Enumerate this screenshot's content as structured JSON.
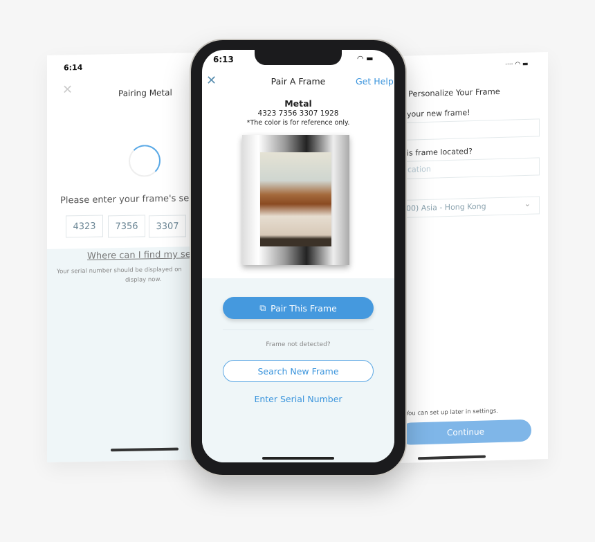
{
  "left_screen": {
    "time": "6:14",
    "title": "Pairing Metal",
    "prompt": "Please enter your frame's serial",
    "serial_parts": [
      "4323",
      "7356",
      "3307"
    ],
    "help_link": "Where can I find my seri",
    "help_text": "Your serial number should be displayed on",
    "help_text2": "display now."
  },
  "center_screen": {
    "time": "6:13",
    "title": "Pair A Frame",
    "get_help": "Get Help",
    "frame_name": "Metal",
    "serial": "4323 7356 3307 1928",
    "note": "*The color is for reference only.",
    "pair_button": "Pair This Frame",
    "not_detected": "Frame not detected?",
    "search_button": "Search New Frame",
    "enter_serial": "Enter Serial Number"
  },
  "right_screen": {
    "title": "Personalize Your Frame",
    "name_label": "your new frame!",
    "location_label": "is frame located?",
    "location_placeholder": "cation",
    "timezone_label": "",
    "timezone_value": "00) Asia - Hong Kong",
    "later_note": "You can set up later in settings.",
    "continue_button": "Continue"
  },
  "colors": {
    "accent": "#3a94dc",
    "light_bg": "#eff6f8"
  }
}
